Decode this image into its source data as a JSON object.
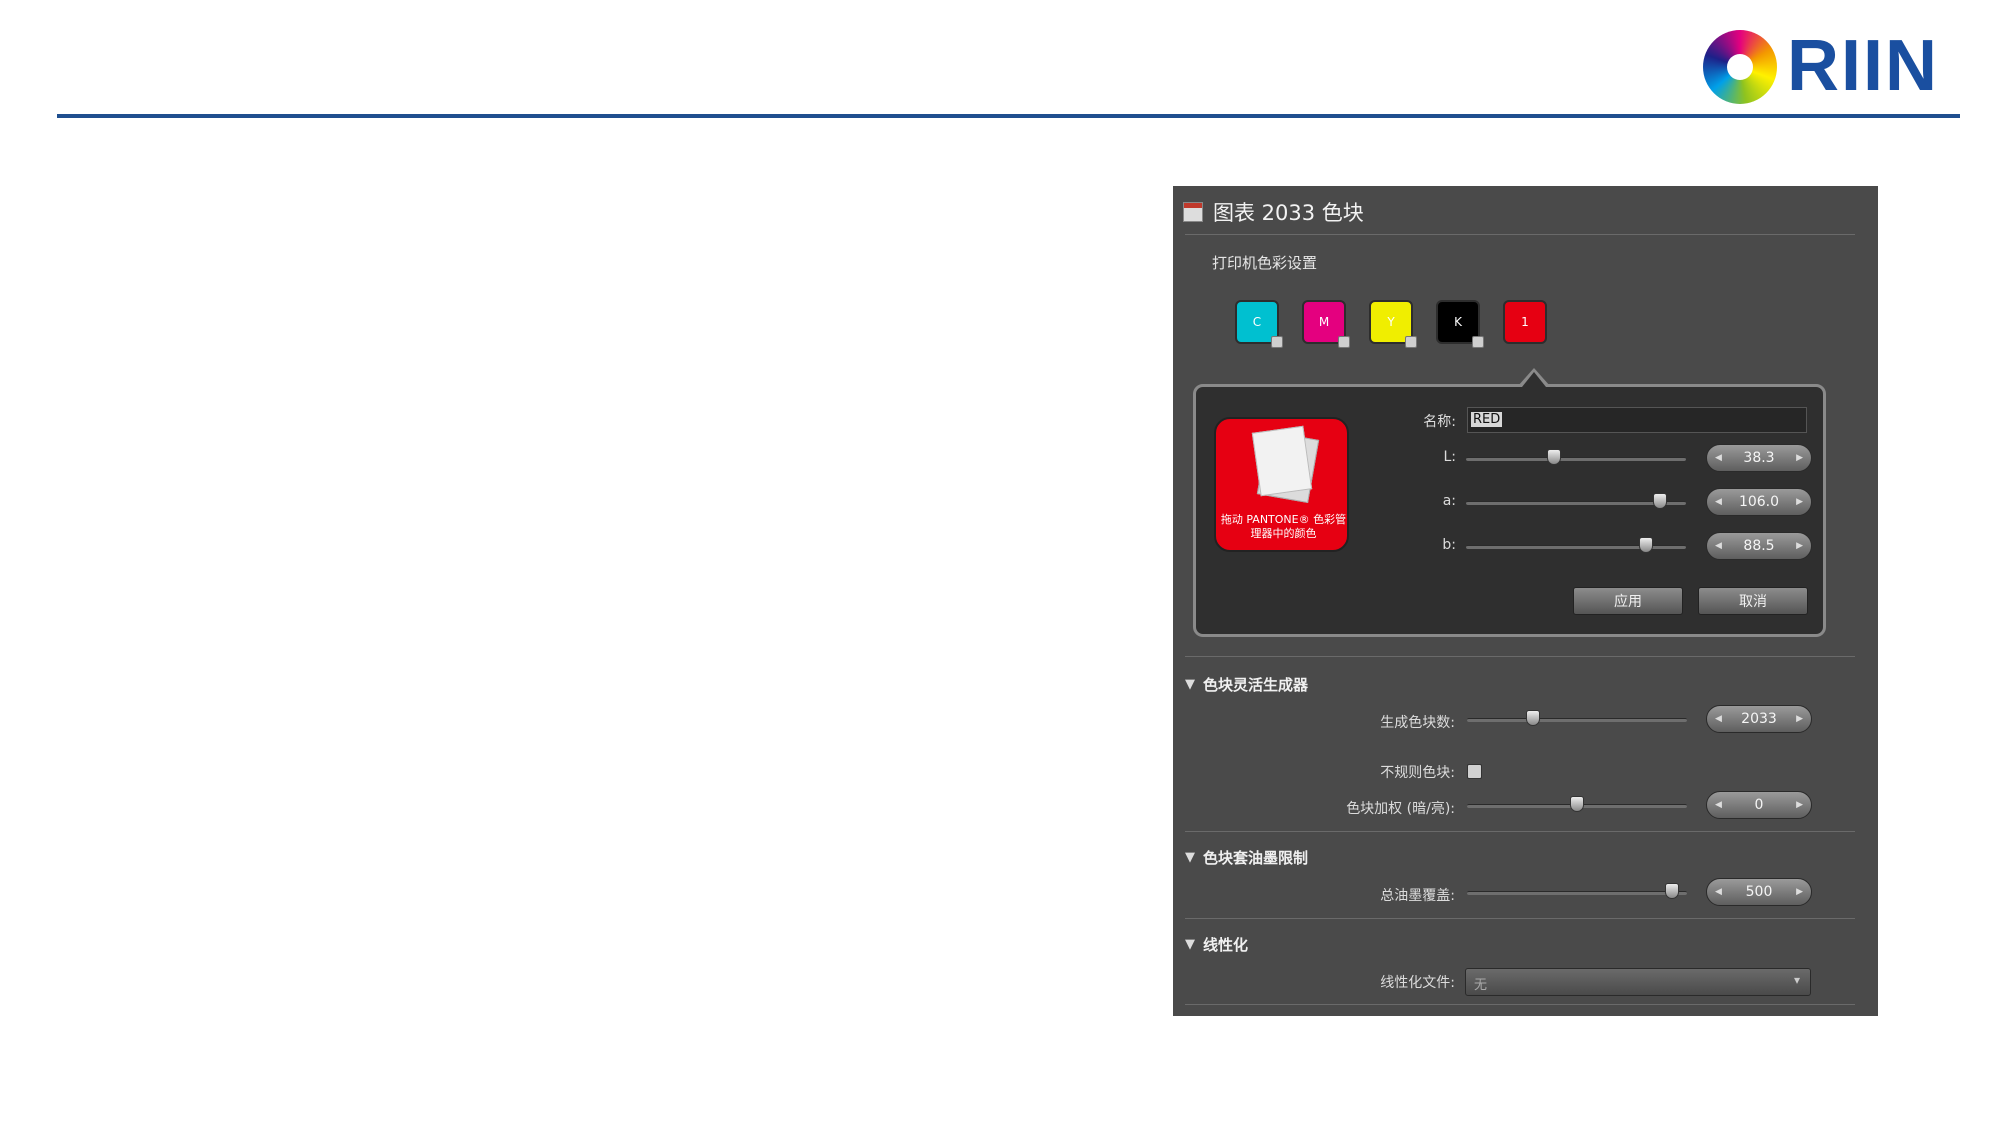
{
  "logo": {
    "text": "RIIN"
  },
  "dialog": {
    "title": "图表 2033 色块",
    "printer_section": "打印机色彩设置",
    "swatches": [
      {
        "label": "C",
        "color": "#00c0d0"
      },
      {
        "label": "M",
        "color": "#e4007f"
      },
      {
        "label": "Y",
        "color": "#f0ee00"
      },
      {
        "label": "K",
        "color": "#000000"
      },
      {
        "label": "1",
        "color": "#e60012"
      }
    ],
    "editor": {
      "big_swatch_caption": "拖动 PANTONE® 色彩管理器中的颜色",
      "name_label": "名称:",
      "name_value": "RED",
      "l_label": "L:",
      "l_value": "38.3",
      "l_fraction": 0.4,
      "a_label": "a:",
      "a_value": "106.0",
      "a_fraction": 0.88,
      "b_label": "b:",
      "b_value": "88.5",
      "b_fraction": 0.82,
      "apply_label": "应用",
      "cancel_label": "取消"
    },
    "generator": {
      "title": "色块灵活生成器",
      "count_label": "生成色块数:",
      "count_value": "2033",
      "count_fraction": 0.3,
      "irregular_label": "不规则色块:",
      "weight_label": "色块加权 (暗/亮):",
      "weight_value": "0",
      "weight_fraction": 0.5
    },
    "ink_limit": {
      "title": "色块套油墨限制",
      "total_label": "总油墨覆盖:",
      "total_value": "500",
      "total_fraction": 0.93
    },
    "linearization": {
      "title": "线性化",
      "file_label": "线性化文件:",
      "file_value": "无"
    }
  }
}
